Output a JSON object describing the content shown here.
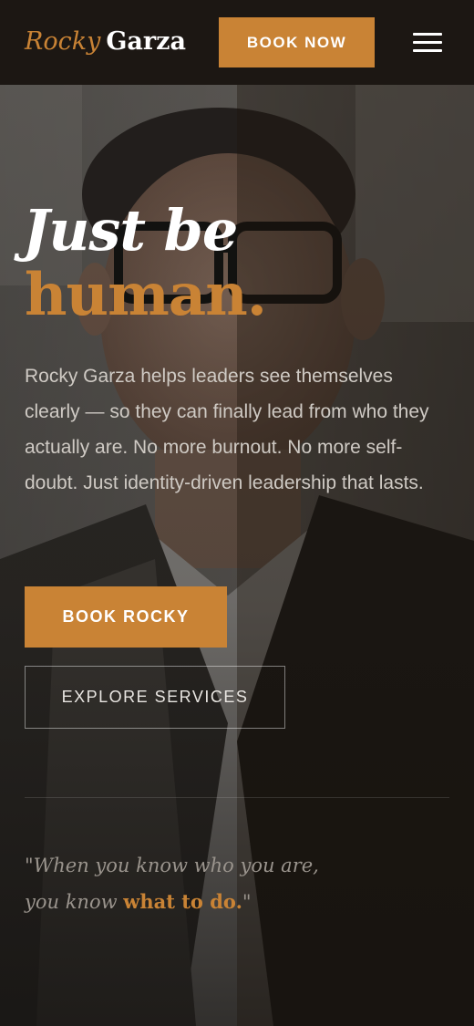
{
  "header": {
    "logo_first": "Rocky",
    "logo_last": "Garza",
    "book_now_label": "BOOK NOW",
    "menu_icon": "hamburger-menu-icon"
  },
  "hero": {
    "headline_line1": "Just be",
    "headline_line2": "human.",
    "intro": "Rocky Garza helps leaders see themselves clearly — so they can finally lead from who they actually are. No more burnout. No more self-doubt. Just identity-driven leadership that lasts.",
    "primary_cta": "BOOK ROCKY",
    "secondary_cta": "EXPLORE SERVICES",
    "quote_line1": "\"When you know who you are,",
    "quote_line2_start": "you know ",
    "quote_accent": "what to do.",
    "quote_end": "\""
  },
  "colors": {
    "accent": "#c98335",
    "header_bg": "#1c1713",
    "text_light": "#ffffff",
    "text_muted": "#cfcac4"
  }
}
